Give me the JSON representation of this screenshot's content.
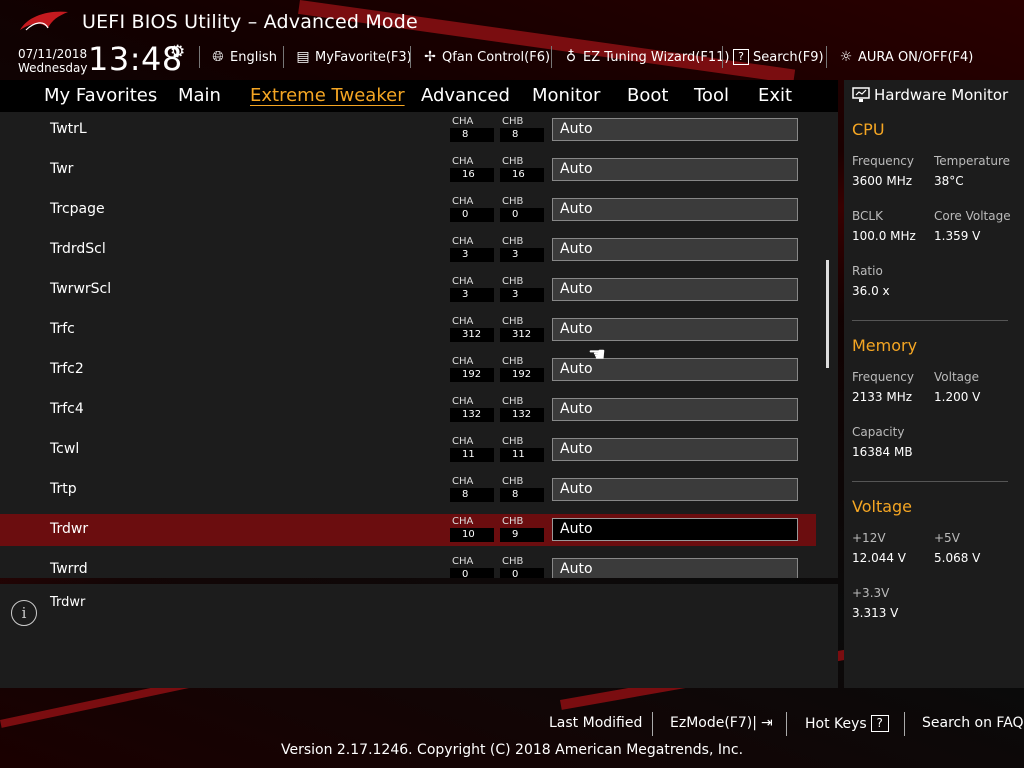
{
  "header": {
    "title": "UEFI BIOS Utility – Advanced Mode",
    "date": "07/11/2018",
    "day": "Wednesday",
    "time": "13:48",
    "toolbar": [
      {
        "label": "English",
        "icon": "globe-icon"
      },
      {
        "label": "MyFavorite(F3)",
        "icon": "favorite-icon"
      },
      {
        "label": "Qfan Control(F6)",
        "icon": "fan-icon"
      },
      {
        "label": "EZ Tuning Wizard(F11)",
        "icon": "bulb-icon"
      },
      {
        "label": "Search(F9)",
        "icon": "search-icon"
      },
      {
        "label": "AURA ON/OFF(F4)",
        "icon": "aura-icon"
      }
    ]
  },
  "nav": {
    "tabs": [
      {
        "label": "My Favorites"
      },
      {
        "label": "Main"
      },
      {
        "label": "Extreme Tweaker",
        "active": true
      },
      {
        "label": "Advanced"
      },
      {
        "label": "Monitor"
      },
      {
        "label": "Boot"
      },
      {
        "label": "Tool"
      },
      {
        "label": "Exit"
      }
    ]
  },
  "settings": {
    "cha_label": "CHA",
    "chb_label": "CHB",
    "rows": [
      {
        "label": "TwtrL",
        "cha": "8",
        "chb": "8",
        "value": "Auto"
      },
      {
        "label": "Twr",
        "cha": "16",
        "chb": "16",
        "value": "Auto"
      },
      {
        "label": "Trcpage",
        "cha": "0",
        "chb": "0",
        "value": "Auto"
      },
      {
        "label": "TrdrdScl",
        "cha": "3",
        "chb": "3",
        "value": "Auto"
      },
      {
        "label": "TwrwrScl",
        "cha": "3",
        "chb": "3",
        "value": "Auto"
      },
      {
        "label": "Trfc",
        "cha": "312",
        "chb": "312",
        "value": "Auto"
      },
      {
        "label": "Trfc2",
        "cha": "192",
        "chb": "192",
        "value": "Auto"
      },
      {
        "label": "Trfc4",
        "cha": "132",
        "chb": "132",
        "value": "Auto"
      },
      {
        "label": "Tcwl",
        "cha": "11",
        "chb": "11",
        "value": "Auto"
      },
      {
        "label": "Trtp",
        "cha": "8",
        "chb": "8",
        "value": "Auto"
      },
      {
        "label": "Trdwr",
        "cha": "10",
        "chb": "9",
        "value": "Auto",
        "selected": true
      },
      {
        "label": "Twrrd",
        "cha": "0",
        "chb": "0",
        "value": "Auto"
      }
    ]
  },
  "help": {
    "text": "Trdwr"
  },
  "hardware_monitor": {
    "title": "Hardware Monitor",
    "cpu": {
      "heading": "CPU",
      "frequency_label": "Frequency",
      "frequency": "3600 MHz",
      "temperature_label": "Temperature",
      "temperature": "38°C",
      "bclk_label": "BCLK",
      "bclk": "100.0 MHz",
      "core_voltage_label": "Core Voltage",
      "core_voltage": "1.359 V",
      "ratio_label": "Ratio",
      "ratio": "36.0 x"
    },
    "memory": {
      "heading": "Memory",
      "frequency_label": "Frequency",
      "frequency": "2133 MHz",
      "voltage_label": "Voltage",
      "voltage": "1.200 V",
      "capacity_label": "Capacity",
      "capacity": "16384 MB"
    },
    "voltage": {
      "heading": "Voltage",
      "v12_label": "+12V",
      "v12": "12.044 V",
      "v5_label": "+5V",
      "v5": "5.068 V",
      "v33_label": "+3.3V",
      "v33": "3.313 V"
    }
  },
  "footer": {
    "last_modified": "Last Modified",
    "ezmode": "EzMode(F7)|",
    "hot_keys": "Hot Keys",
    "hot_keys_key": "?",
    "search_faq": "Search on FAQ",
    "copyright": "Version 2.17.1246. Copyright (C) 2018 American Megatrends, Inc."
  },
  "colors": {
    "accent": "#f5a623",
    "selected_row": "#6b0d0f",
    "panel": "#1c1c1c"
  }
}
